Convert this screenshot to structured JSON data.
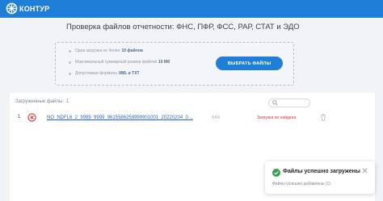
{
  "app": {
    "logo_text": "КОНТУР",
    "page_title": "Проверка файлов отчетности: ФНС, ПФР, ФСС, РАР, СТАТ и ЭДО"
  },
  "upload": {
    "hint1_prefix": "Одна загрузка не более",
    "hint1_value": "10 файлов",
    "hint2_prefix": "Максимальный суммарный размер файлов",
    "hint2_value": "10 Мб",
    "hint3_prefix": "Допустимые форматы",
    "hint3_value": "XML и TXT",
    "choose_button": "ВЫБРАТЬ ФАЙЛЫ"
  },
  "files": {
    "header_label": "Загруженные файлы:",
    "header_count": "1",
    "rows": [
      {
        "index": "1",
        "name": "NO_NDFL6_2_9999_9999_9615586259999901001_20220204_0…",
        "size": "9 Кб",
        "status": "Загрузка не найдена",
        "status_icon": "error-x-circle-icon",
        "delete_icon": "trash-icon"
      }
    ]
  },
  "toast": {
    "title": "Файлы успешно загружены",
    "subtitle": "Файлы успешно добавлены (1)"
  },
  "colors": {
    "brand": "#1f7fd8",
    "error": "#d13438",
    "success": "#2ea44f",
    "link": "#2a67b8"
  }
}
